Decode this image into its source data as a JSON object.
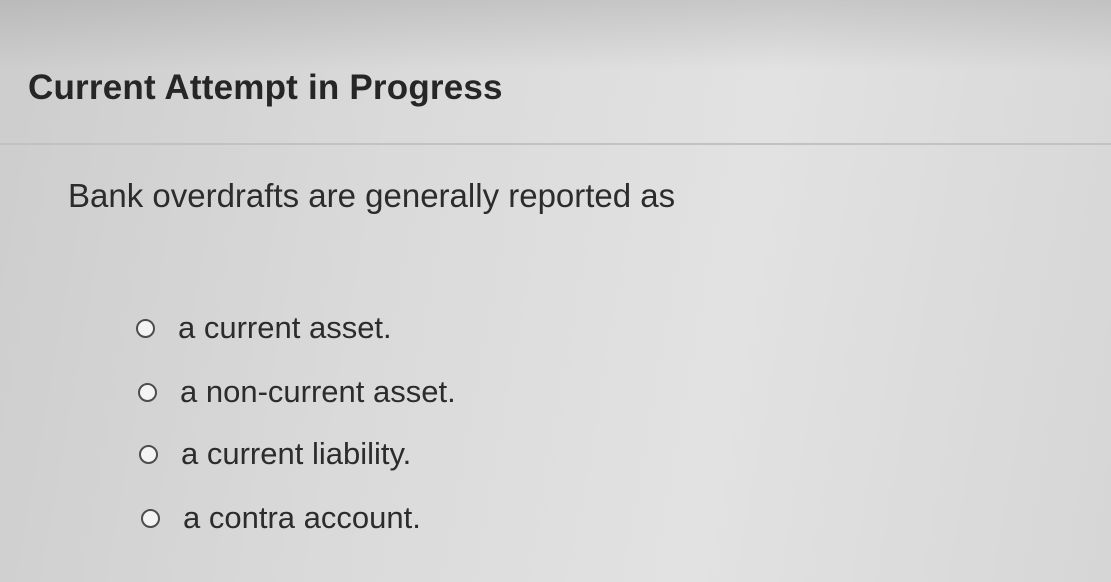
{
  "header": {
    "title": "Current Attempt in Progress"
  },
  "question": {
    "text": "Bank overdrafts are generally reported as",
    "options": [
      {
        "label": "a current asset.",
        "selected": false
      },
      {
        "label": "a non-current asset.",
        "selected": false
      },
      {
        "label": "a current liability.",
        "selected": false
      },
      {
        "label": "a contra account.",
        "selected": false
      }
    ]
  }
}
